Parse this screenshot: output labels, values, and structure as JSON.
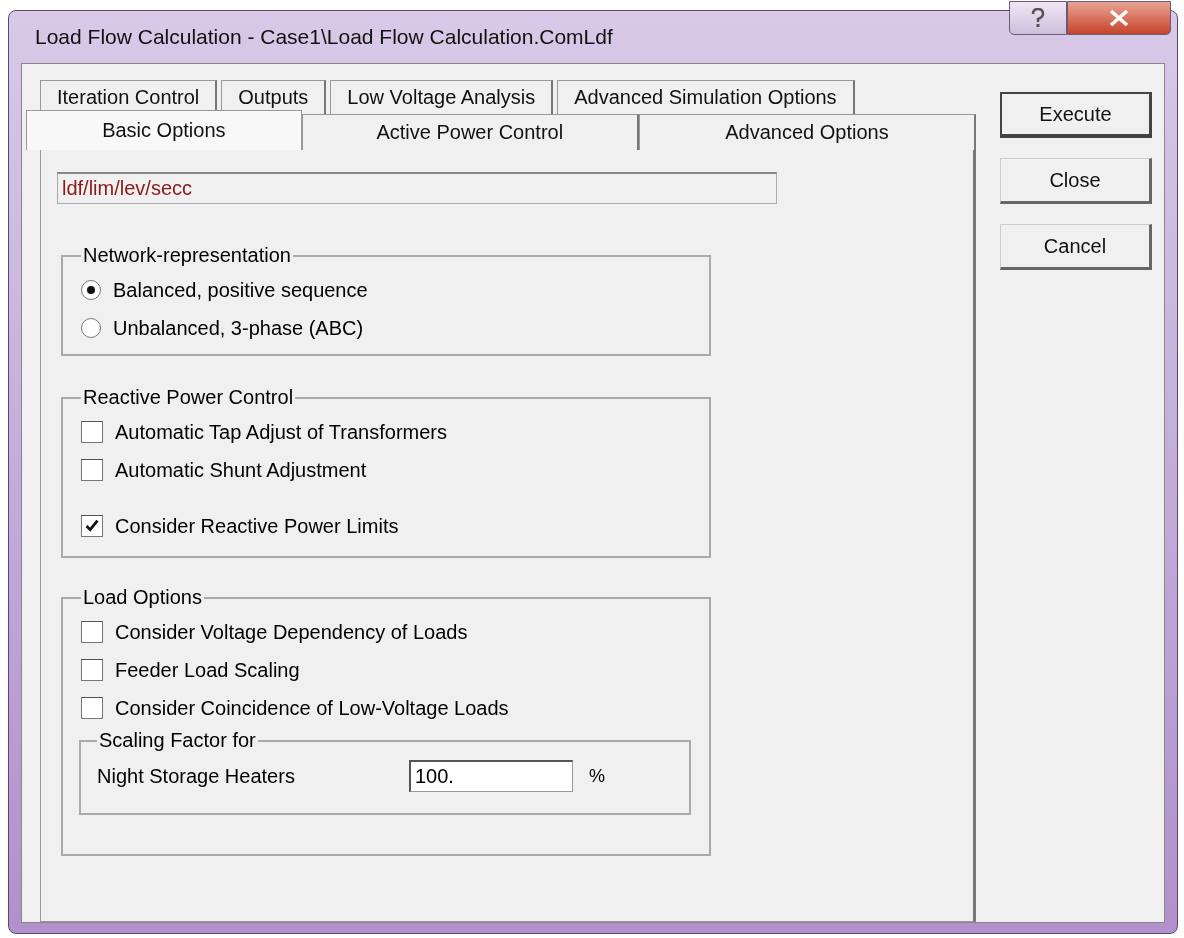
{
  "window": {
    "title": "Load Flow Calculation - Case1\\Load Flow Calculation.ComLdf"
  },
  "tab_rows": [
    {
      "tabs": [
        {
          "label": "Iteration Control",
          "selected": false
        },
        {
          "label": "Outputs",
          "selected": false
        },
        {
          "label": "Low Voltage Analysis",
          "selected": false
        },
        {
          "label": "Advanced Simulation Options",
          "selected": false
        }
      ]
    },
    {
      "tabs": [
        {
          "label": "Basic Options",
          "selected": true
        },
        {
          "label": "Active Power Control",
          "selected": false
        },
        {
          "label": "Advanced Options",
          "selected": false
        }
      ]
    }
  ],
  "command_field": {
    "value": "ldf/lim/lev/secc"
  },
  "network_representation": {
    "title": "Network-representation",
    "options": [
      {
        "label": "Balanced, positive sequence",
        "selected": true
      },
      {
        "label": "Unbalanced, 3-phase (ABC)",
        "selected": false
      }
    ]
  },
  "reactive_power_control": {
    "title": "Reactive Power Control",
    "items": [
      {
        "label": "Automatic Tap Adjust of Transformers",
        "checked": false
      },
      {
        "label": "Automatic Shunt Adjustment",
        "checked": false
      },
      {
        "label": "Consider Reactive Power Limits",
        "checked": true
      }
    ]
  },
  "load_options": {
    "title": "Load Options",
    "items": [
      {
        "label": "Consider Voltage Dependency of Loads",
        "checked": false
      },
      {
        "label": "Feeder Load Scaling",
        "checked": false
      },
      {
        "label": "Consider Coincidence of Low-Voltage Loads",
        "checked": false
      }
    ],
    "scaling": {
      "title": "Scaling Factor for",
      "label": "Night Storage Heaters",
      "value": "100.",
      "unit": "%"
    }
  },
  "buttons": [
    {
      "label": "Execute"
    },
    {
      "label": "Close"
    },
    {
      "label": "Cancel"
    }
  ]
}
